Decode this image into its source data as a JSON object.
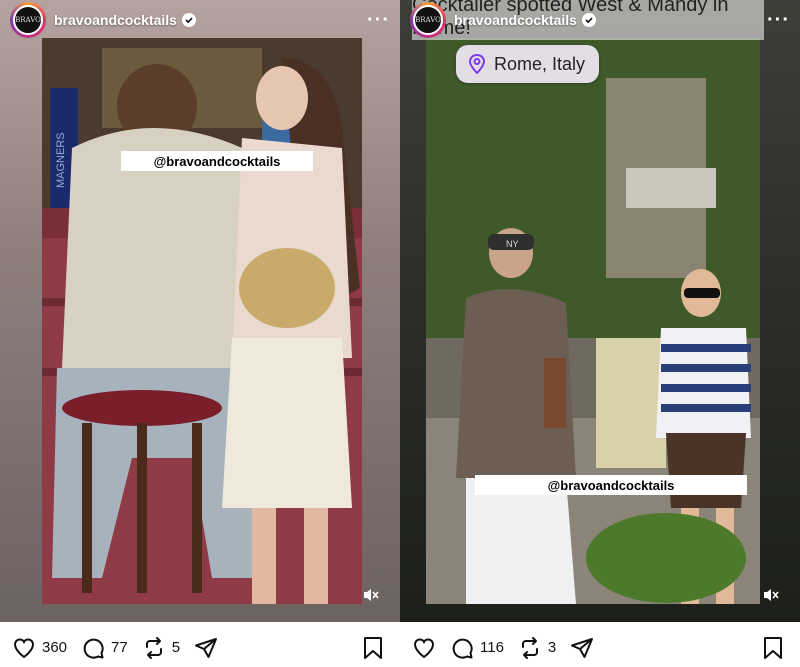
{
  "posts": [
    {
      "username": "bravoandcocktails",
      "avatar_text": "BRAVO",
      "watermark": "@bravoandcocktails",
      "likes": "360",
      "comments": "77",
      "reposts": "5",
      "image_text": "MAGNERS"
    },
    {
      "username": "bravoandcocktails",
      "avatar_text": "BRAVO",
      "watermark": "@bravoandcocktails",
      "title_overlay": "Cocktailer spotted West & Mandy in Rome!",
      "location": "Rome, Italy",
      "likes": "116",
      "comments": "",
      "reposts": "3",
      "image_text": "NY"
    }
  ],
  "icons": {
    "like": "heart-icon",
    "comment": "comment-icon",
    "repost": "repost-icon",
    "share": "send-icon",
    "save": "bookmark-icon",
    "mute": "speaker-muted-icon",
    "location": "location-pin-icon"
  },
  "colors": {
    "location_pin": "#7c3aed",
    "verified": "#3897f0"
  }
}
